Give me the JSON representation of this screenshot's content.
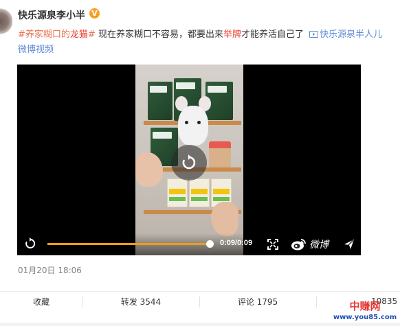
{
  "author": {
    "name": "快乐源泉李小半",
    "badge": "V"
  },
  "post": {
    "topic1": "#养家糊口的",
    "topic1_red": "龙猫",
    "topic1_end": "#",
    "text1": " 现在养家糊口不容易，都要出来",
    "text_red": "举牌",
    "text2": "才能养活自己了",
    "video_link": "快乐源泉半人儿",
    "video_link2": "微博视频"
  },
  "player": {
    "time": "0:09/0:09",
    "progress": 1.0,
    "brand": "微博"
  },
  "timestamp": "01月20日 18:06",
  "actions": {
    "favorite": "收藏",
    "repost": "转发 3544",
    "comment": "评论 1795",
    "likes": "10835"
  },
  "watermark": {
    "cn": "中赚网",
    "url": "www.you85.com"
  },
  "colors": {
    "accent": "#f09a18",
    "link": "#eb7350",
    "blue_link": "#5d8bd8",
    "red": "#eb3b2d"
  }
}
